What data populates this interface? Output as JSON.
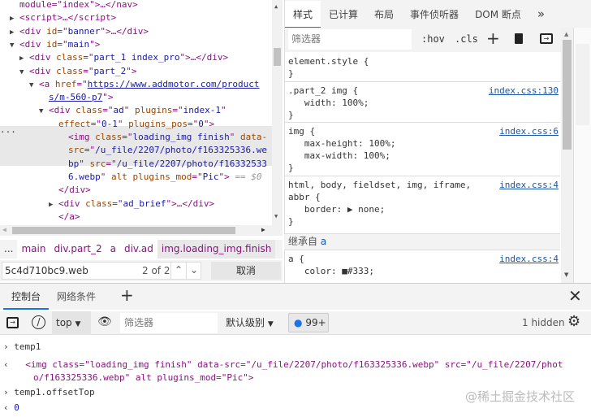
{
  "elements": {
    "lines": [
      {
        "i": 1,
        "a": "",
        "t": [
          [
            "tag",
            "module=\"index\">…</nav>"
          ]
        ]
      },
      {
        "i": 1,
        "a": "▶",
        "t": [
          [
            "tag",
            "<script>…</script>"
          ]
        ]
      },
      {
        "i": 1,
        "a": "▶",
        "t": [
          [
            "tag",
            "<div "
          ],
          [
            "attr",
            "id"
          ],
          [
            "tag",
            "=\""
          ],
          [
            "val",
            "banner"
          ],
          [
            "tag",
            "\">…</div>"
          ]
        ]
      },
      {
        "i": 1,
        "a": "▼",
        "t": [
          [
            "tag",
            "<div "
          ],
          [
            "attr",
            "id"
          ],
          [
            "tag",
            "=\""
          ],
          [
            "val",
            "main"
          ],
          [
            "tag",
            "\">"
          ]
        ]
      },
      {
        "i": 2,
        "a": "▶",
        "t": [
          [
            "tag",
            "<div "
          ],
          [
            "attr",
            "class"
          ],
          [
            "tag",
            "=\""
          ],
          [
            "val",
            "part_1 index_pro"
          ],
          [
            "tag",
            "\">…</div>"
          ]
        ]
      },
      {
        "i": 2,
        "a": "▼",
        "t": [
          [
            "tag",
            "<div "
          ],
          [
            "attr",
            "class"
          ],
          [
            "tag",
            "=\""
          ],
          [
            "val",
            "part_2"
          ],
          [
            "tag",
            "\">"
          ]
        ]
      },
      {
        "i": 3,
        "a": "▼",
        "t": [
          [
            "tag",
            "<a "
          ],
          [
            "attr",
            "href"
          ],
          [
            "tag",
            "=\""
          ],
          [
            "link",
            "https://www.addmotor.com/product"
          ]
        ]
      },
      {
        "i": 4,
        "a": "",
        "t": [
          [
            "link",
            "s/m-560-p7"
          ],
          [
            "tag",
            "\">"
          ]
        ]
      },
      {
        "i": 4,
        "a": "▼",
        "t": [
          [
            "tag",
            "<div "
          ],
          [
            "attr",
            "class"
          ],
          [
            "tag",
            "=\""
          ],
          [
            "val",
            "ad"
          ],
          [
            "tag",
            "\" "
          ],
          [
            "attr",
            "plugins"
          ],
          [
            "tag",
            "=\""
          ],
          [
            "val",
            "index-1"
          ],
          [
            "tag",
            "\""
          ]
        ]
      },
      {
        "i": 5,
        "a": "",
        "t": [
          [
            "attr",
            "effect"
          ],
          [
            "tag",
            "=\""
          ],
          [
            "val",
            "0-1"
          ],
          [
            "tag",
            "\" "
          ],
          [
            "attr",
            "plugins_pos"
          ],
          [
            "tag",
            "=\""
          ],
          [
            "val",
            "0"
          ],
          [
            "tag",
            "\">"
          ]
        ]
      },
      {
        "i": 6,
        "a": "",
        "t": [
          [
            "tag",
            "<img "
          ],
          [
            "attr",
            "class"
          ],
          [
            "tag",
            "=\""
          ],
          [
            "val",
            "loading_img finish"
          ],
          [
            "tag",
            "\" "
          ],
          [
            "attr",
            "data-"
          ]
        ]
      },
      {
        "i": 6,
        "a": "",
        "t": [
          [
            "attr",
            "src"
          ],
          [
            "tag",
            "=\""
          ],
          [
            "val",
            "/u_file/2207/photo/f163325336.we"
          ]
        ]
      },
      {
        "i": 6,
        "a": "",
        "t": [
          [
            "val",
            "bp"
          ],
          [
            "tag",
            "\" "
          ],
          [
            "attr",
            "src"
          ],
          [
            "tag",
            "=\""
          ],
          [
            "val",
            "/u_file/2207/photo/f16332533"
          ]
        ]
      },
      {
        "i": 6,
        "a": "",
        "t": [
          [
            "val",
            "6.webp"
          ],
          [
            "tag",
            "\" "
          ],
          [
            "attr",
            "alt plugins_mod"
          ],
          [
            "tag",
            "=\""
          ],
          [
            "val",
            "Pic"
          ],
          [
            "tag",
            "\">"
          ],
          [
            "dim",
            " == $0"
          ]
        ]
      },
      {
        "i": 5,
        "a": "",
        "t": [
          [
            "tag",
            "</div>"
          ]
        ]
      },
      {
        "i": 5,
        "a": "▶",
        "t": [
          [
            "tag",
            "<div "
          ],
          [
            "attr",
            "class"
          ],
          [
            "tag",
            "=\""
          ],
          [
            "val",
            "ad_brief"
          ],
          [
            "tag",
            "\">…</div>"
          ]
        ]
      },
      {
        "i": 5,
        "a": "",
        "t": [
          [
            "tag",
            "</a>"
          ]
        ]
      },
      {
        "i": 4,
        "a": "",
        "t": [
          [
            "tag",
            "</div>"
          ]
        ]
      }
    ],
    "ellipsis": "..."
  },
  "breadcrumbs": {
    "more_left": "...",
    "items": [
      "main",
      "div.part_2",
      "a",
      "div.ad",
      "img.loading_img.finish"
    ],
    "more_right": "..."
  },
  "search": {
    "value": "5c4d710bc9.web",
    "count": "2 of 2",
    "cancel": "取消"
  },
  "styles": {
    "tabs": [
      "样式",
      "已计算",
      "布局",
      "事件侦听器",
      "DOM 断点"
    ],
    "more_tabs": "»",
    "filter_placeholder": "筛选器",
    "hov": ":hov",
    "cls": ".cls",
    "rules": [
      {
        "text": "element.style {\n}",
        "src": ""
      },
      {
        "text": ".part_2 img {\n   width: 100%;\n}",
        "src": "index.css:130"
      },
      {
        "text": "img {\n   max-height: 100%;\n   max-width: 100%;\n}",
        "src": "index.css:6"
      },
      {
        "text": "html, body, fieldset, img, iframe,\nabbr {\n   border: ▶ none;\n}",
        "src": "index.css:4"
      },
      {
        "text": "a {\n   color: ■#333;",
        "src": "index.css:4"
      }
    ],
    "inherited": "继承自",
    "inherited_from": "a"
  },
  "drawer": {
    "tabs": [
      "控制台",
      "网络条件"
    ],
    "context": "top",
    "filter_placeholder": "筛选器",
    "level": "默认级别",
    "badge": "99+",
    "hidden": "1 hidden",
    "console": [
      {
        "type": "in",
        "text": "temp1"
      },
      {
        "type": "out",
        "text": "<img class=\"loading_img finish\" data-src=\"/u_file/2207/photo/f163325336.webp\" src=\"/u_file/2207/phot",
        "text2": "o/f163325336.webp\" alt plugins_mod=\"Pic\">"
      },
      {
        "type": "in",
        "text": "temp1.offsetTop"
      },
      {
        "type": "out",
        "text": "0"
      }
    ],
    "watermark": "@稀土掘金技术社区"
  },
  "colors": {
    "accent": "#1a73e8",
    "tag": "#881280",
    "attr": "#994500",
    "value": "#1a1aa6"
  }
}
